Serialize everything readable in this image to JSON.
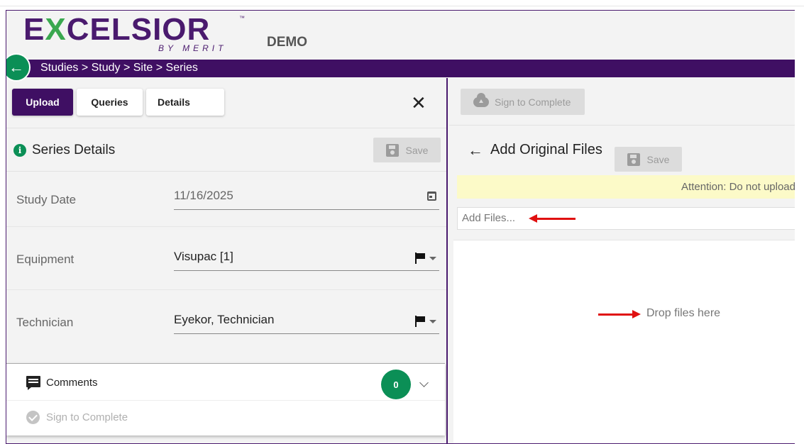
{
  "app": {
    "logo_main_pre": "E",
    "logo_main_x": "X",
    "logo_main_post": "CELSIOR",
    "logo_tm": "™",
    "logo_sub": "BY MERIT",
    "environment": "DEMO"
  },
  "breadcrumb": "Studies > Study > Site > Series",
  "back_icon": "arrow-left-icon",
  "tabs": [
    {
      "label": "Upload",
      "active": true
    },
    {
      "label": "Queries",
      "active": false
    },
    {
      "label": "Details",
      "active": false
    }
  ],
  "close_glyph": "✕",
  "series_details": {
    "info_glyph": "i",
    "title": "Series Details",
    "save_label": "Save",
    "fields": [
      {
        "label": "Study Date",
        "value": "11/16/2025",
        "control": "calendar-icon"
      },
      {
        "label": "Equipment",
        "value": "Visupac [1]",
        "control": "flag-dropdown"
      },
      {
        "label": "Technician",
        "value": "Eyekor, Technician",
        "control": "flag-dropdown"
      }
    ]
  },
  "comments": {
    "label": "Comments",
    "count": "0"
  },
  "sign_to_complete_label": "Sign to Complete",
  "right_panel": {
    "sign_to_complete_label": "Sign to Complete",
    "back_glyph": "←",
    "title": "Add Original Files",
    "save_label": "Save",
    "attention": "Attention: Do not upload",
    "add_files_placeholder": "Add Files...",
    "drop_text": "Drop files here"
  },
  "colors": {
    "brand_purple": "#3f0f63",
    "brand_green": "#0b8f56",
    "annotation_red": "#e01010",
    "attention_bg": "#fcfac8"
  }
}
